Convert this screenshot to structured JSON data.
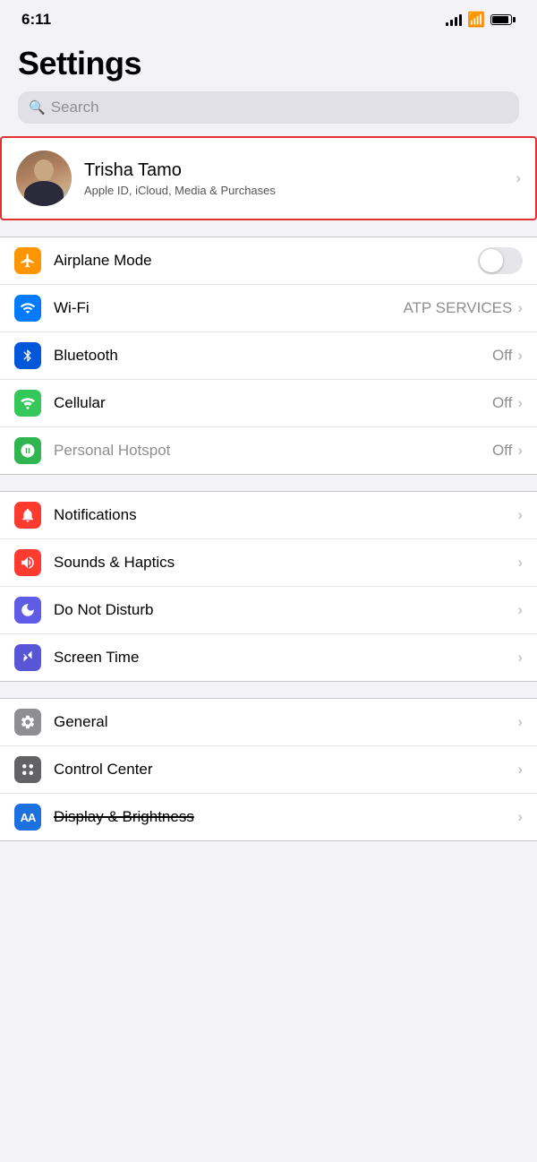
{
  "statusBar": {
    "time": "6:11"
  },
  "pageTitle": "Settings",
  "search": {
    "placeholder": "Search"
  },
  "profile": {
    "name": "Trisha Tamo",
    "subtitle": "Apple ID, iCloud, Media & Purchases"
  },
  "sections": [
    {
      "id": "connectivity",
      "rows": [
        {
          "id": "airplane-mode",
          "label": "Airplane Mode",
          "icon": "✈",
          "iconClass": "icon-orange",
          "type": "toggle",
          "value": ""
        },
        {
          "id": "wifi",
          "label": "Wi-Fi",
          "icon": "wifi",
          "iconClass": "icon-blue",
          "type": "value-chevron",
          "value": "ATP SERVICES"
        },
        {
          "id": "bluetooth",
          "label": "Bluetooth",
          "icon": "bluetooth",
          "iconClass": "icon-blue-dark",
          "type": "value-chevron",
          "value": "Off"
        },
        {
          "id": "cellular",
          "label": "Cellular",
          "icon": "cellular",
          "iconClass": "icon-green",
          "type": "value-chevron",
          "value": "Off"
        },
        {
          "id": "hotspot",
          "label": "Personal Hotspot",
          "icon": "hotspot",
          "iconClass": "icon-green-dark",
          "type": "value-chevron",
          "value": "Off",
          "disabled": true
        }
      ]
    },
    {
      "id": "notifications-group",
      "rows": [
        {
          "id": "notifications",
          "label": "Notifications",
          "icon": "notif",
          "iconClass": "icon-red-pink",
          "type": "chevron"
        },
        {
          "id": "sounds",
          "label": "Sounds & Haptics",
          "icon": "sound",
          "iconClass": "icon-red-pink",
          "type": "chevron"
        },
        {
          "id": "do-not-disturb",
          "label": "Do Not Disturb",
          "icon": "moon",
          "iconClass": "icon-indigo",
          "type": "chevron"
        },
        {
          "id": "screen-time",
          "label": "Screen Time",
          "icon": "hourglass",
          "iconClass": "icon-purple",
          "type": "chevron"
        }
      ]
    },
    {
      "id": "general-group",
      "rows": [
        {
          "id": "general",
          "label": "General",
          "icon": "gear",
          "iconClass": "icon-gray",
          "type": "chevron"
        },
        {
          "id": "control-center",
          "label": "Control Center",
          "icon": "sliders",
          "iconClass": "icon-gray2",
          "type": "chevron"
        },
        {
          "id": "display",
          "label": "Display & Brightness",
          "icon": "AA",
          "iconClass": "icon-blue-aa",
          "type": "chevron",
          "crossed": true
        }
      ]
    }
  ],
  "labels": {
    "off": "Off",
    "atpServices": "ATP SERVICES"
  }
}
